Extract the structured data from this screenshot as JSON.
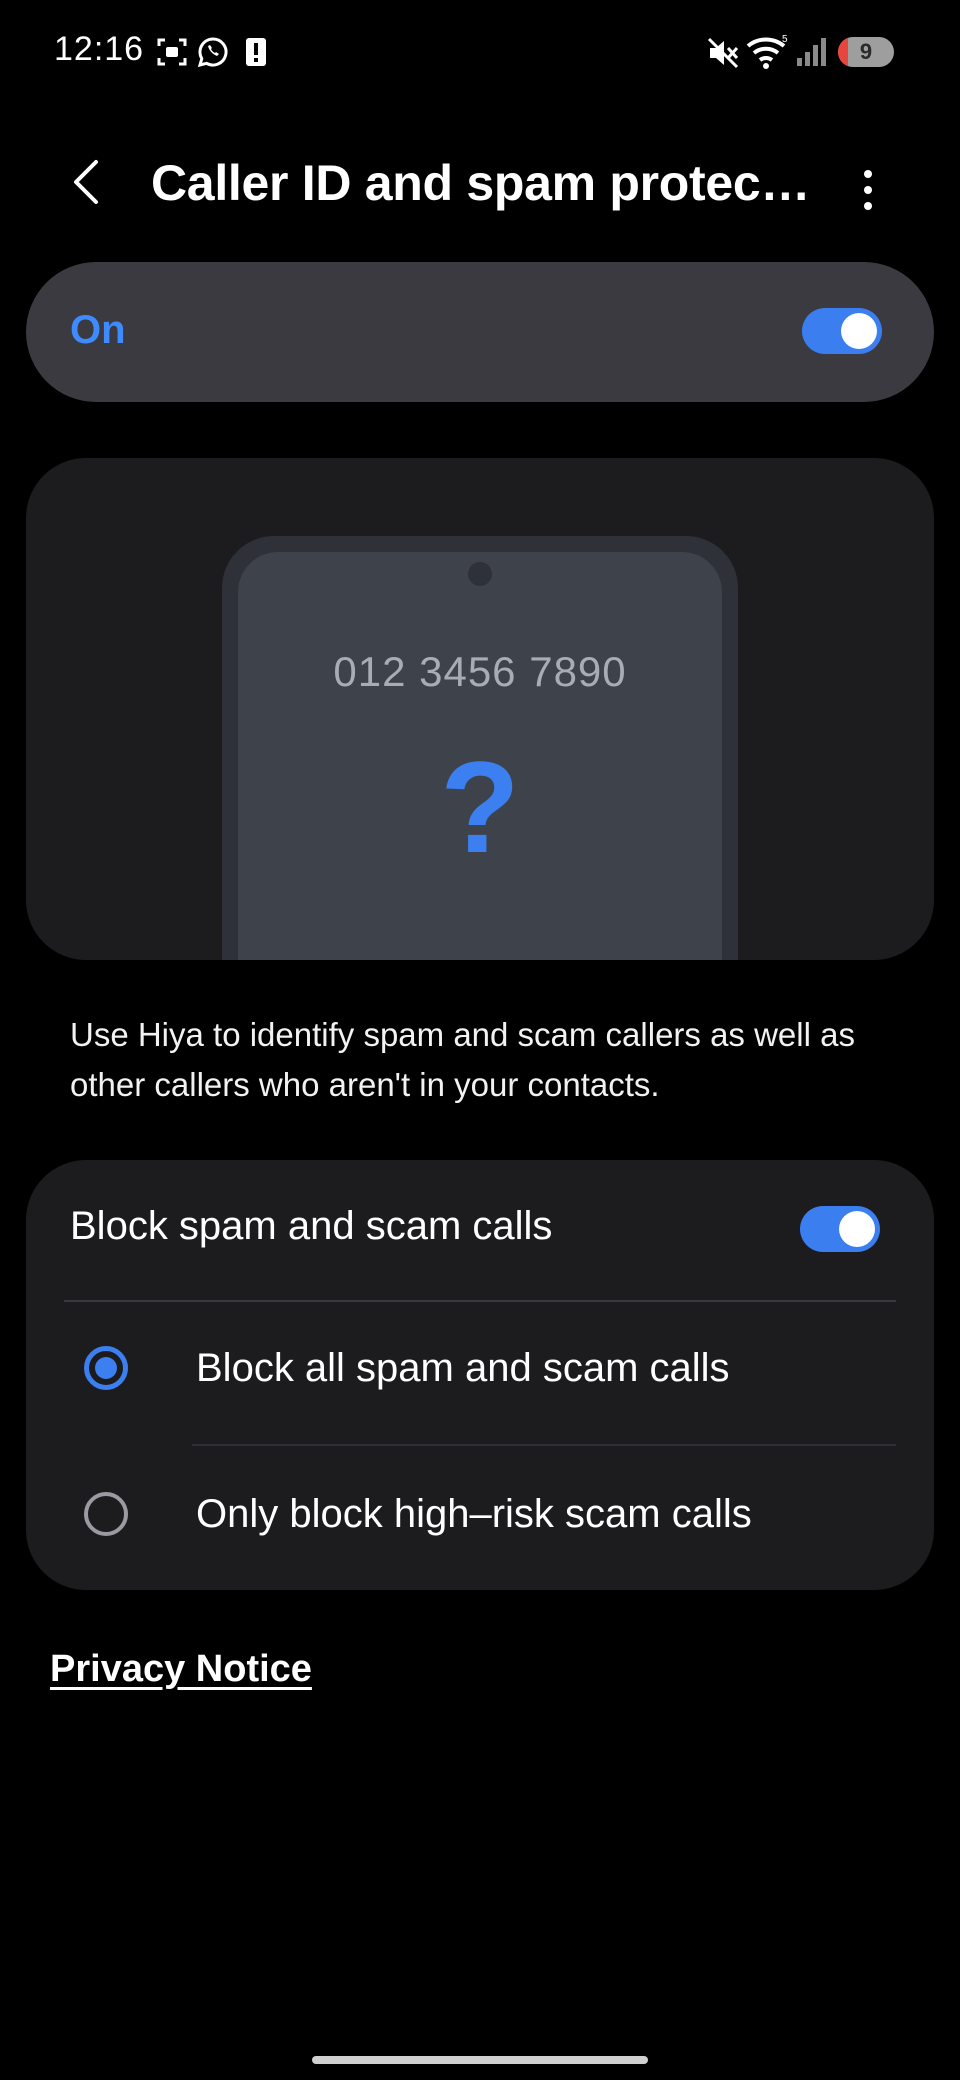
{
  "status_bar": {
    "time": "12:16",
    "notification_icons": [
      "screenshot-icon",
      "whatsapp-icon",
      "alert-icon"
    ],
    "system_icons": [
      "mute-icon",
      "wifi-icon",
      "signal-icon"
    ],
    "battery_level": "9"
  },
  "app_bar": {
    "title": "Caller ID and spam protec…"
  },
  "master_switch": {
    "label": "On",
    "state": true
  },
  "illustration": {
    "number": "012 3456 7890",
    "symbol": "?"
  },
  "description": "Use Hiya to identify spam and scam callers as well as other callers who aren't in your contacts.",
  "block_section": {
    "title": "Block spam and scam calls",
    "state": true,
    "options": [
      {
        "label": "Block all spam and scam calls",
        "selected": true
      },
      {
        "label": "Only block high–risk scam calls",
        "selected": false
      }
    ]
  },
  "privacy_notice": "Privacy Notice",
  "colors": {
    "accent": "#3b7ff0",
    "background": "#000000",
    "card": "#1c1c1f",
    "master_card": "#3a3a40"
  }
}
